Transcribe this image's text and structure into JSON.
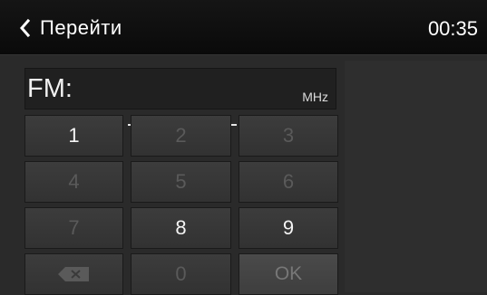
{
  "header": {
    "title": "Перейти",
    "clock": "00:35"
  },
  "display": {
    "band_label": "FM:",
    "frequency_placeholder": "___.__",
    "frequency_text": "___ . __",
    "unit": "MHz"
  },
  "keypad": {
    "keys": [
      {
        "label": "1",
        "enabled": true
      },
      {
        "label": "2",
        "enabled": false
      },
      {
        "label": "3",
        "enabled": false
      },
      {
        "label": "4",
        "enabled": false
      },
      {
        "label": "5",
        "enabled": false
      },
      {
        "label": "6",
        "enabled": false
      },
      {
        "label": "7",
        "enabled": false
      },
      {
        "label": "8",
        "enabled": true
      },
      {
        "label": "9",
        "enabled": true
      },
      {
        "label": "",
        "icon": "backspace-icon",
        "enabled": false
      },
      {
        "label": "0",
        "enabled": false
      },
      {
        "label": "OK",
        "enabled": false
      }
    ]
  },
  "colors": {
    "background": "#2a2a2a",
    "topbar": "#0f0f0f",
    "key": "#383838",
    "key_disabled_text": "#5a5a5a",
    "text": "#ffffff"
  }
}
